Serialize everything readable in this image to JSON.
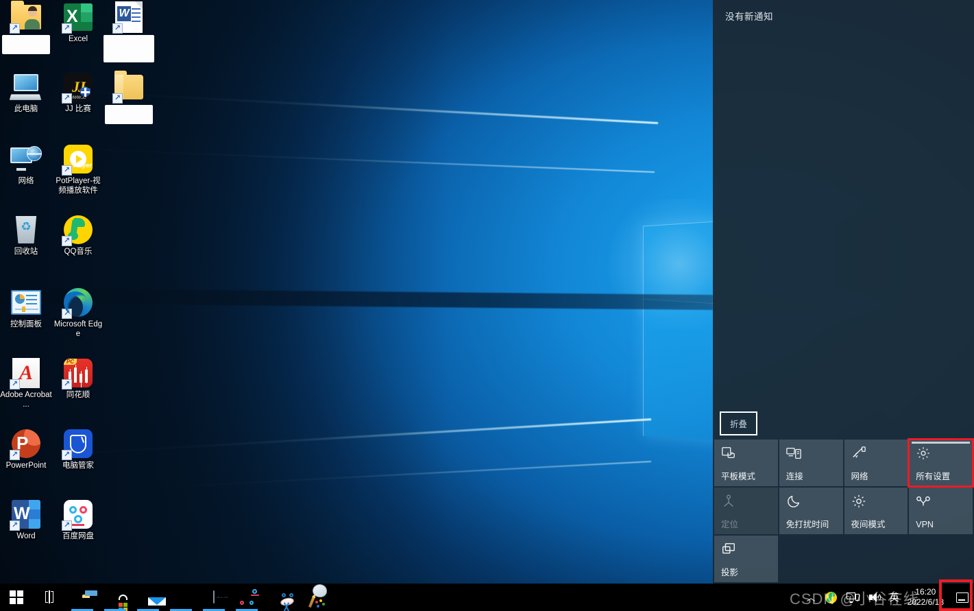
{
  "desktop": {
    "icons": [
      {
        "label": "",
        "redacted": true,
        "art": "user-folder-icon",
        "col": 0,
        "row": 0,
        "shortcut": true
      },
      {
        "label": "Excel",
        "redacted": false,
        "art": "excel-icon",
        "col": 1,
        "row": 0,
        "shortcut": true
      },
      {
        "label": "",
        "redacted": true,
        "art": "word-document-icon",
        "col": 2,
        "row": 0,
        "shortcut": true
      },
      {
        "label": "此电脑",
        "redacted": false,
        "art": "this-pc-icon",
        "col": 0,
        "row": 1,
        "shortcut": false
      },
      {
        "label": "JJ 比赛",
        "redacted": false,
        "art": "jj-game-icon",
        "col": 1,
        "row": 1,
        "shortcut": true
      },
      {
        "label": "",
        "redacted": true,
        "art": "folder-icon",
        "col": 2,
        "row": 1,
        "shortcut": true
      },
      {
        "label": "网络",
        "redacted": false,
        "art": "network-icon",
        "col": 0,
        "row": 2,
        "shortcut": false
      },
      {
        "label": "PotPlayer-视频播放软件",
        "redacted": false,
        "art": "potplayer-icon",
        "col": 1,
        "row": 2,
        "shortcut": true
      },
      {
        "label": "回收站",
        "redacted": false,
        "art": "recycle-bin-icon",
        "col": 0,
        "row": 3,
        "shortcut": false
      },
      {
        "label": "QQ音乐",
        "redacted": false,
        "art": "qq-music-icon",
        "col": 1,
        "row": 3,
        "shortcut": true
      },
      {
        "label": "控制面板",
        "redacted": false,
        "art": "control-panel-icon",
        "col": 0,
        "row": 4,
        "shortcut": false
      },
      {
        "label": "Microsoft Edge",
        "redacted": false,
        "art": "edge-icon",
        "col": 1,
        "row": 4,
        "shortcut": true
      },
      {
        "label": "Adobe Acrobat ...",
        "redacted": false,
        "art": "acrobat-icon",
        "col": 0,
        "row": 5,
        "shortcut": true
      },
      {
        "label": "同花顺",
        "redacted": false,
        "art": "tonghuashun-icon",
        "col": 1,
        "row": 5,
        "shortcut": true
      },
      {
        "label": "PowerPoint",
        "redacted": false,
        "art": "powerpoint-icon",
        "col": 0,
        "row": 6,
        "shortcut": true
      },
      {
        "label": "电脑管家",
        "redacted": false,
        "art": "pc-manager-icon",
        "col": 1,
        "row": 6,
        "shortcut": true
      },
      {
        "label": "Word",
        "redacted": false,
        "art": "word-icon",
        "col": 0,
        "row": 7,
        "shortcut": true
      },
      {
        "label": "百度网盘",
        "redacted": false,
        "art": "baidu-netdisk-icon",
        "col": 1,
        "row": 7,
        "shortcut": true
      }
    ]
  },
  "action_center": {
    "title": "没有新通知",
    "collapse_label": "折叠",
    "accent_highlight": "#ec1c24",
    "quick_actions": [
      {
        "label": "平板模式",
        "icon": "tablet-mode-icon",
        "state": "normal",
        "highlight": false
      },
      {
        "label": "连接",
        "icon": "connect-icon",
        "state": "normal",
        "highlight": false
      },
      {
        "label": "网络",
        "icon": "wifi-icon",
        "state": "normal",
        "highlight": false
      },
      {
        "label": "所有设置",
        "icon": "gear-icon",
        "state": "hovered",
        "highlight": true
      },
      {
        "label": "定位",
        "icon": "location-icon",
        "state": "disabled",
        "highlight": false
      },
      {
        "label": "免打扰时间",
        "icon": "moon-icon",
        "state": "normal",
        "highlight": false
      },
      {
        "label": "夜间模式",
        "icon": "sun-icon",
        "state": "normal",
        "highlight": false
      },
      {
        "label": "VPN",
        "icon": "vpn-icon",
        "state": "normal",
        "highlight": false
      },
      {
        "label": "投影",
        "icon": "project-icon",
        "state": "normal",
        "highlight": false
      }
    ]
  },
  "taskbar": {
    "buttons": [
      {
        "name": "start-button",
        "icon": "windows-logo-icon",
        "running": false
      },
      {
        "name": "task-view-button",
        "icon": "task-view-icon",
        "running": false
      },
      {
        "name": "file-explorer-button",
        "icon": "folder-icon",
        "running": true
      },
      {
        "name": "microsoft-store-button",
        "icon": "store-bag-icon",
        "running": true
      },
      {
        "name": "mail-button",
        "icon": "envelope-icon",
        "running": true
      },
      {
        "name": "edge-button",
        "icon": "edge-icon",
        "running": true
      },
      {
        "name": "task-manager-button",
        "icon": "task-manager-icon",
        "running": true
      },
      {
        "name": "baidu-netdisk-button",
        "icon": "baidu-netdisk-icon",
        "running": true
      },
      {
        "name": "snipping-tool-button",
        "icon": "scissors-icon",
        "running": false
      },
      {
        "name": "paint-button",
        "icon": "paint-palette-icon",
        "running": false
      }
    ],
    "tray": {
      "overflow_icon": "chevron-up-icon",
      "icons": [
        {
          "name": "qq-music-tray-icon"
        },
        {
          "name": "network-tray-icon"
        },
        {
          "name": "volume-tray-icon"
        }
      ],
      "ime_label": "英",
      "clock": {
        "time": "16:20",
        "date": "2022/6/18"
      },
      "action_center_icon": "action-center-icon"
    }
  },
  "watermark": {
    "text": "CSDN @小谷在线"
  }
}
